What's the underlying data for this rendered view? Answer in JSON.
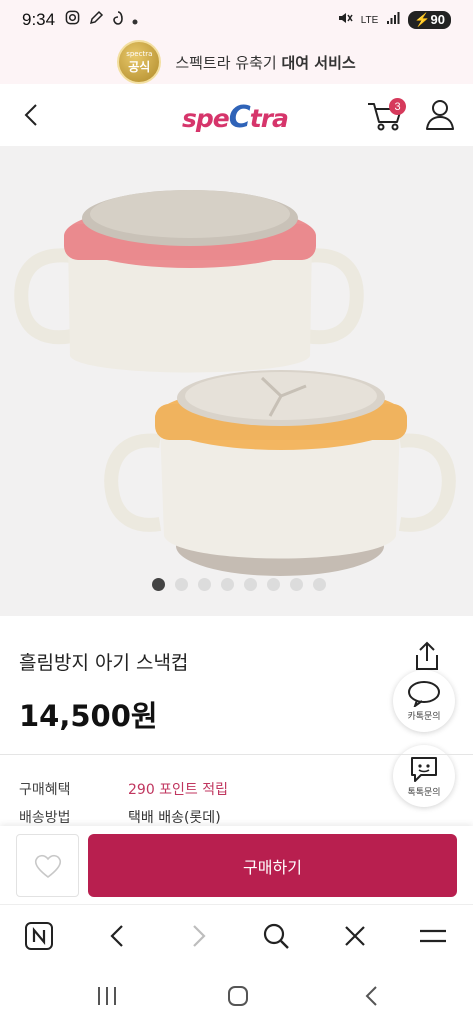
{
  "status_bar": {
    "time": "9:34",
    "network": "LTE",
    "battery": "90"
  },
  "promo": {
    "badge_small": "spectra",
    "badge_main": "공식",
    "text_plain": "스펙트라 유축기 ",
    "text_bold": "대여 서비스"
  },
  "header": {
    "logo_prefix": "spe",
    "logo_cap": "C",
    "logo_suffix": "tra",
    "cart_count": "3"
  },
  "product": {
    "title": "흘림방지 아기 스낵컵",
    "price": "14,500원",
    "carousel_total": 8,
    "carousel_active": 1
  },
  "floating": {
    "kakao_label": "카톡문의",
    "talk_label": "톡톡문의"
  },
  "details": {
    "benefit_label": "구매혜택",
    "benefit_value": "290 포인트 적립",
    "shipping_label": "배송방법",
    "shipping_value": "택배 배송(롯데)"
  },
  "buy": {
    "label": "구매하기"
  },
  "colors": {
    "accent": "#b81f4f",
    "logo_pink": "#d6356b",
    "logo_blue": "#2f63b8"
  }
}
